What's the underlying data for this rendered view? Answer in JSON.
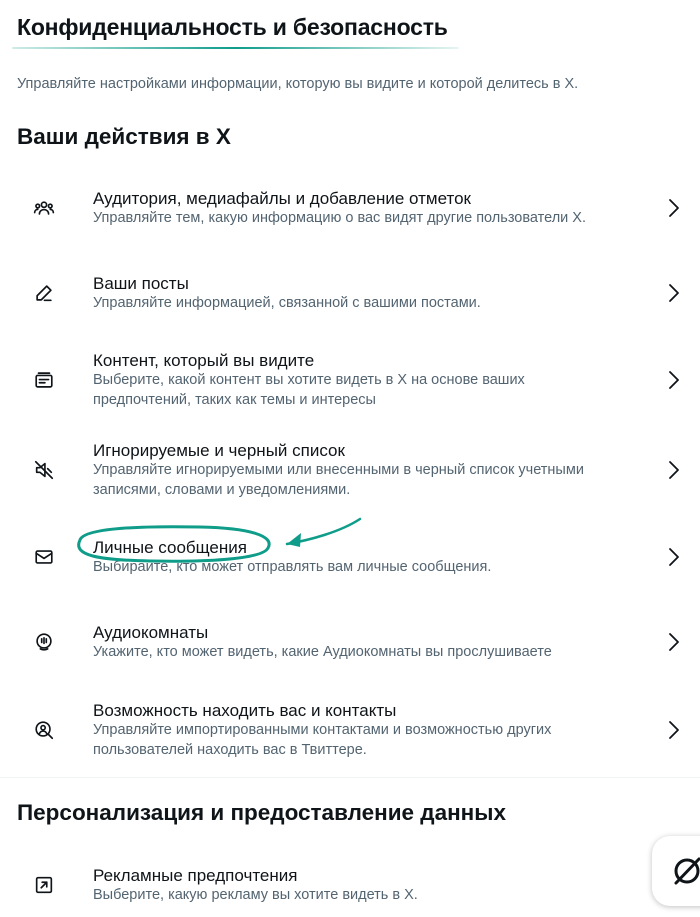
{
  "header": {
    "title": "Конфиденциальность и безопасность",
    "description": "Управляйте настройками информации, которую вы видите и которой делитесь в X."
  },
  "sections": [
    {
      "heading": "Ваши действия в X",
      "items": [
        {
          "label": "Аудитория, медиафайлы и добавление отметок",
          "sub": "Управляйте тем, какую информацию о вас видят другие пользователи X.",
          "icon": "people-group-icon"
        },
        {
          "label": "Ваши посты",
          "sub": "Управляйте информацией, связанной с вашими постами.",
          "icon": "pencil-icon"
        },
        {
          "label": "Контент, который вы видите",
          "sub": "Выберите, какой контент вы хотите видеть в X на основе ваших предпочтений, таких как темы и интересы",
          "icon": "content-card-icon"
        },
        {
          "label": "Игнорируемые и черный список",
          "sub": "Управляйте игнорируемыми или внесенными в черный список учетными записями, словами и уведомлениями.",
          "icon": "muted-speaker-icon"
        },
        {
          "label": "Личные сообщения",
          "sub": "Выбирайте, кто может отправлять вам личные сообщения.",
          "icon": "envelope-icon"
        },
        {
          "label": "Аудиокомнаты",
          "sub": "Укажите, кто может видеть, какие Аудиокомнаты вы прослушиваете",
          "icon": "microphone-icon"
        },
        {
          "label": "Возможность находить вас и контакты",
          "sub": "Управляйте импортированными контактами и возможностью других пользователей находить вас в Твиттере.",
          "icon": "person-search-icon"
        }
      ]
    },
    {
      "heading": "Персонализация и предоставление данных",
      "items": [
        {
          "label": "Рекламные предпочтения",
          "sub": "Выберите, какую рекламу вы хотите видеть в X.",
          "icon": "external-arrow-icon"
        }
      ]
    }
  ],
  "colors": {
    "annotation": "#0f9d8a",
    "text_primary": "#0f1419",
    "text_secondary": "#536471"
  }
}
